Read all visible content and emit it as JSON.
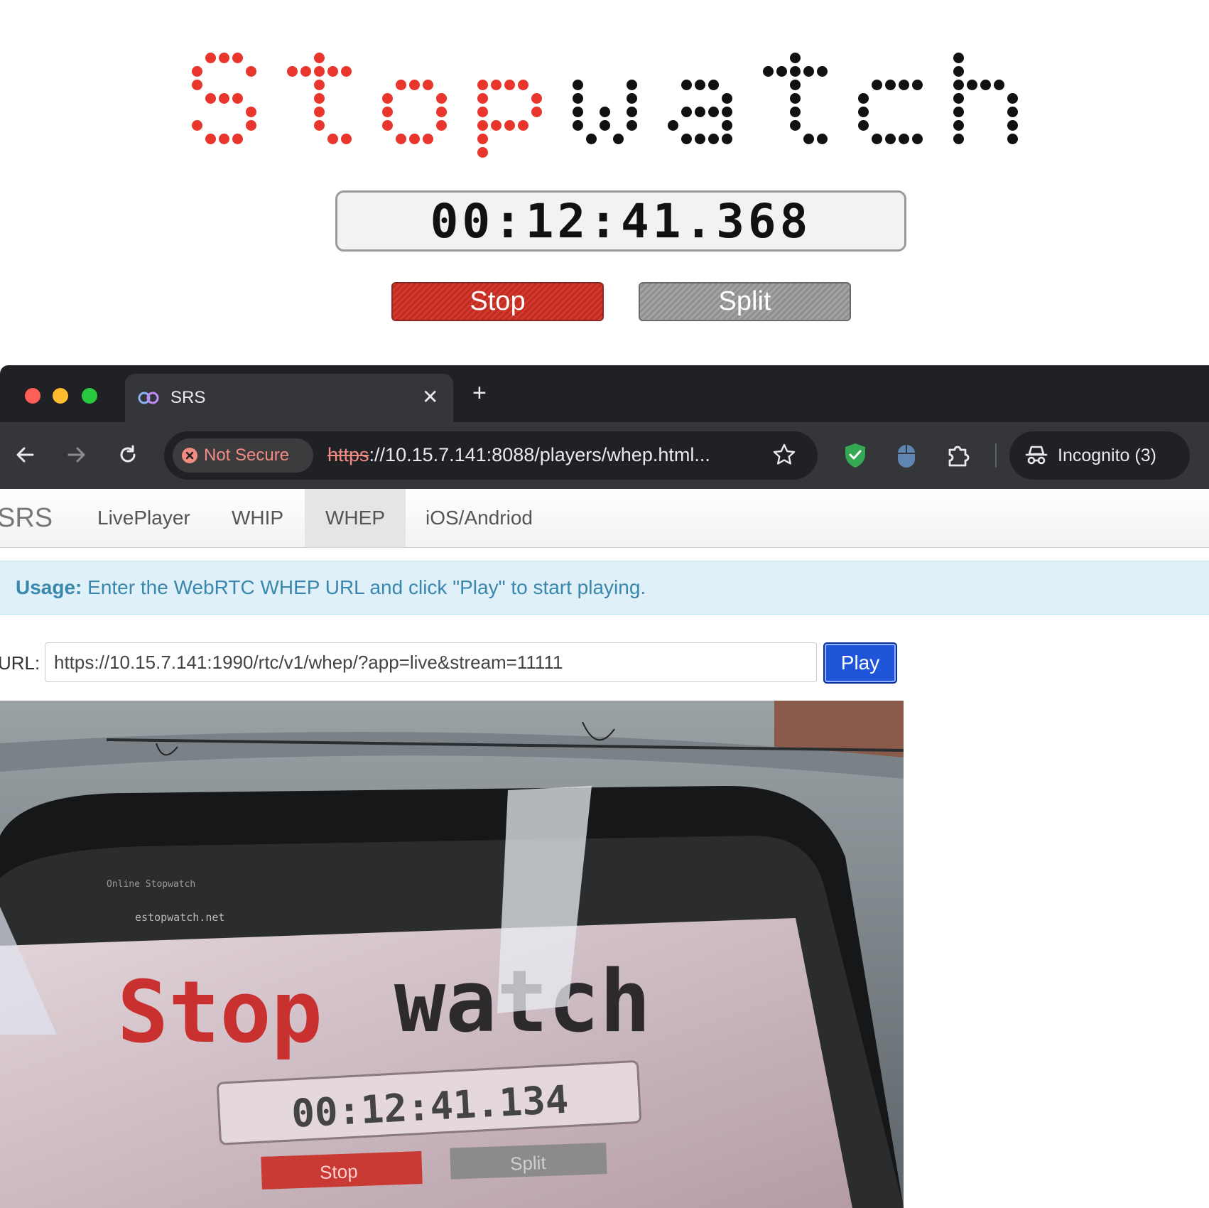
{
  "stopwatch": {
    "title": "Stopwatch",
    "time": "00:12:41.368",
    "stop_label": "Stop",
    "split_label": "Split",
    "colors": {
      "red": "#e8362c",
      "black": "#111111"
    }
  },
  "browser": {
    "tab": {
      "title": "SRS",
      "icon": "srs-logo-icon",
      "close_icon": "close-icon"
    },
    "new_tab_icon": "plus-icon",
    "nav": {
      "back_icon": "back-arrow-icon",
      "forward_icon": "forward-arrow-icon",
      "reload_icon": "reload-icon"
    },
    "security_chip": "Not Secure",
    "url_scheme": "https",
    "url_rest": "://10.15.7.141:8088/players/whep.html...",
    "bookmark_icon": "star-icon",
    "extensions": [
      "shield-check-icon",
      "mouse-icon",
      "puzzle-icon"
    ],
    "incognito_label": "Incognito (3)"
  },
  "page": {
    "brand": "SRS",
    "nav_items": [
      "LivePlayer",
      "WHIP",
      "WHEP",
      "iOS/Andriod"
    ],
    "active_nav": "WHEP",
    "usage_label": "Usage:",
    "usage_text": "Enter the WebRTC WHEP URL and click \"Play\" to start playing.",
    "url_label": "URL:",
    "url_value": "https://10.15.7.141:1990/rtc/v1/whep/?app=live&stream=11111",
    "play_label": "Play",
    "video": {
      "tab_title": "Online Stopwatch",
      "address": "estopwatch.net",
      "stopwatch_title": "Stopwatch",
      "time": "00:12:41.134",
      "stop_label": "Stop",
      "split_label": "Split"
    }
  }
}
